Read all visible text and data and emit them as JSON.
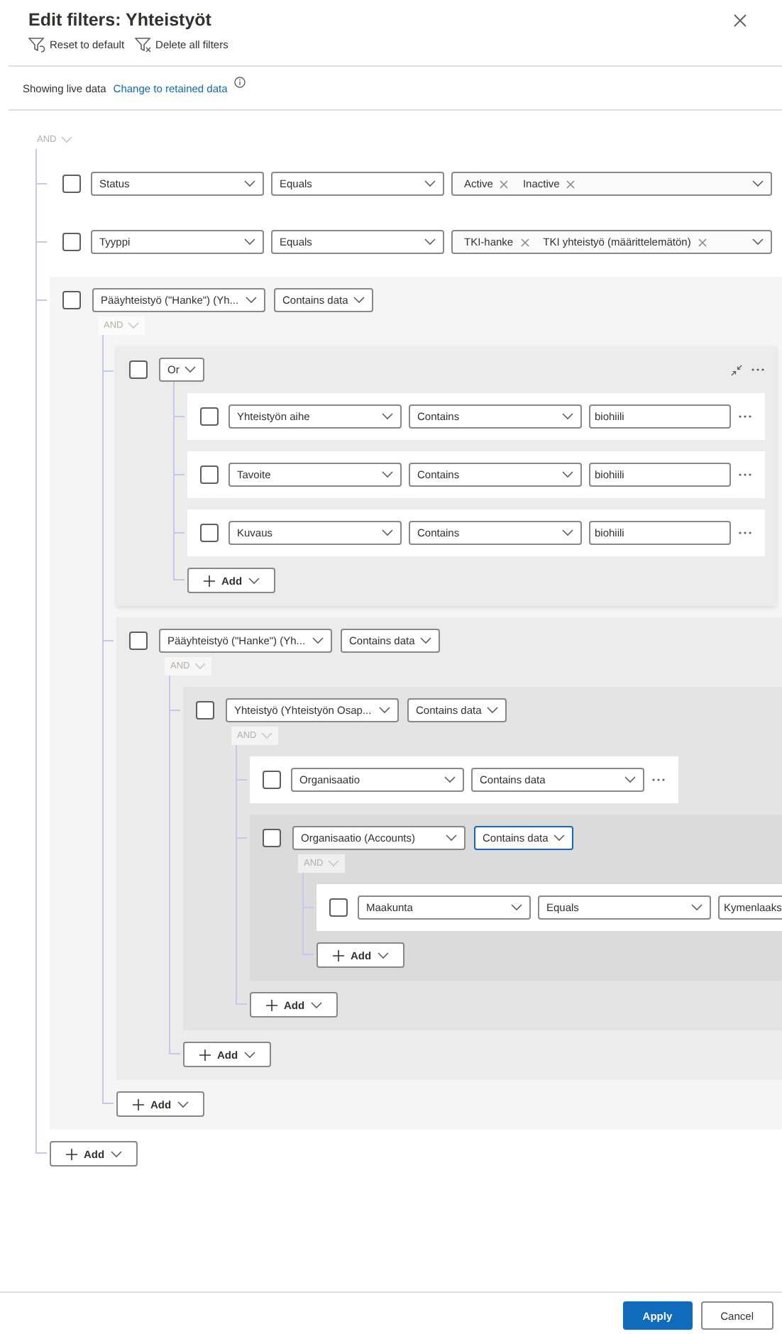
{
  "dialog": {
    "title": "Edit filters: Yhteistyöt"
  },
  "toolbar": [
    {
      "kind": "reset",
      "label": "Reset to default"
    },
    {
      "kind": "delete",
      "label": "Delete all filters"
    }
  ],
  "data_source": {
    "text": "Showing live data",
    "link": "Change to retained data"
  },
  "filter": {
    "operator": "AND",
    "add_label": "Add",
    "rows": [
      {
        "kind": "condition",
        "checked": false,
        "field": "Status",
        "operator": "Equals",
        "operator_focused": false,
        "tags": [
          "Active",
          "Inactive"
        ],
        "more_button": false
      },
      {
        "kind": "condition",
        "checked": false,
        "field": "Tyyppi",
        "operator": "Equals",
        "operator_focused": false,
        "tags": [
          "TKI-hanke",
          "TKI yhteistyö (määrittelemätön)"
        ],
        "more_button": false
      },
      {
        "kind": "related",
        "checked": false,
        "field": "Pääyhteistyö (\"Hanke\") (Yh...",
        "operator": "Contains data",
        "operator_focused": false,
        "group": {
          "operator": "AND",
          "add_label": "Add",
          "rows": [
            {
              "kind": "group",
              "checked": false,
              "operator": "Or",
              "add_label": "Add",
              "rows": [
                {
                  "kind": "condition",
                  "checked": false,
                  "field": "Yhteistyön aihe",
                  "operator": "Contains",
                  "operator_focused": false,
                  "value": "biohiili",
                  "more_button": true
                },
                {
                  "kind": "condition",
                  "checked": false,
                  "field": "Tavoite",
                  "operator": "Contains",
                  "operator_focused": false,
                  "value": "biohiili",
                  "more_button": true
                },
                {
                  "kind": "condition",
                  "checked": false,
                  "field": "Kuvaus",
                  "operator": "Contains",
                  "operator_focused": false,
                  "value": "biohiili",
                  "more_button": true
                }
              ]
            },
            {
              "kind": "related",
              "checked": false,
              "field": "Pääyhteistyö (\"Hanke\") (Yh...",
              "operator": "Contains data",
              "operator_focused": false,
              "group": {
                "operator": "AND",
                "add_label": "Add",
                "rows": [
                  {
                    "kind": "related",
                    "checked": false,
                    "field": "Yhteistyö (Yhteistyön Osap...",
                    "operator": "Contains data",
                    "operator_focused": false,
                    "group": {
                      "operator": "AND",
                      "add_label": "Add",
                      "rows": [
                        {
                          "kind": "condition",
                          "checked": false,
                          "field": "Organisaatio",
                          "operator": "Contains data",
                          "operator_focused": false,
                          "more_button": true
                        },
                        {
                          "kind": "related",
                          "checked": false,
                          "field": "Organisaatio (Accounts)",
                          "operator": "Contains data",
                          "operator_focused": true,
                          "group": {
                            "operator": "AND",
                            "add_label": "Add",
                            "rows": [
                              {
                                "kind": "condition",
                                "checked": false,
                                "field": "Maakunta",
                                "operator": "Equals",
                                "operator_focused": false,
                                "value": "Kymenlaaks",
                                "more_button": false
                              }
                            ]
                          }
                        }
                      ]
                    }
                  }
                ]
              }
            }
          ]
        }
      }
    ]
  },
  "buttons": [
    {
      "kind": "primary",
      "label": "Apply"
    },
    {
      "kind": "secondary",
      "label": "Cancel"
    }
  ]
}
